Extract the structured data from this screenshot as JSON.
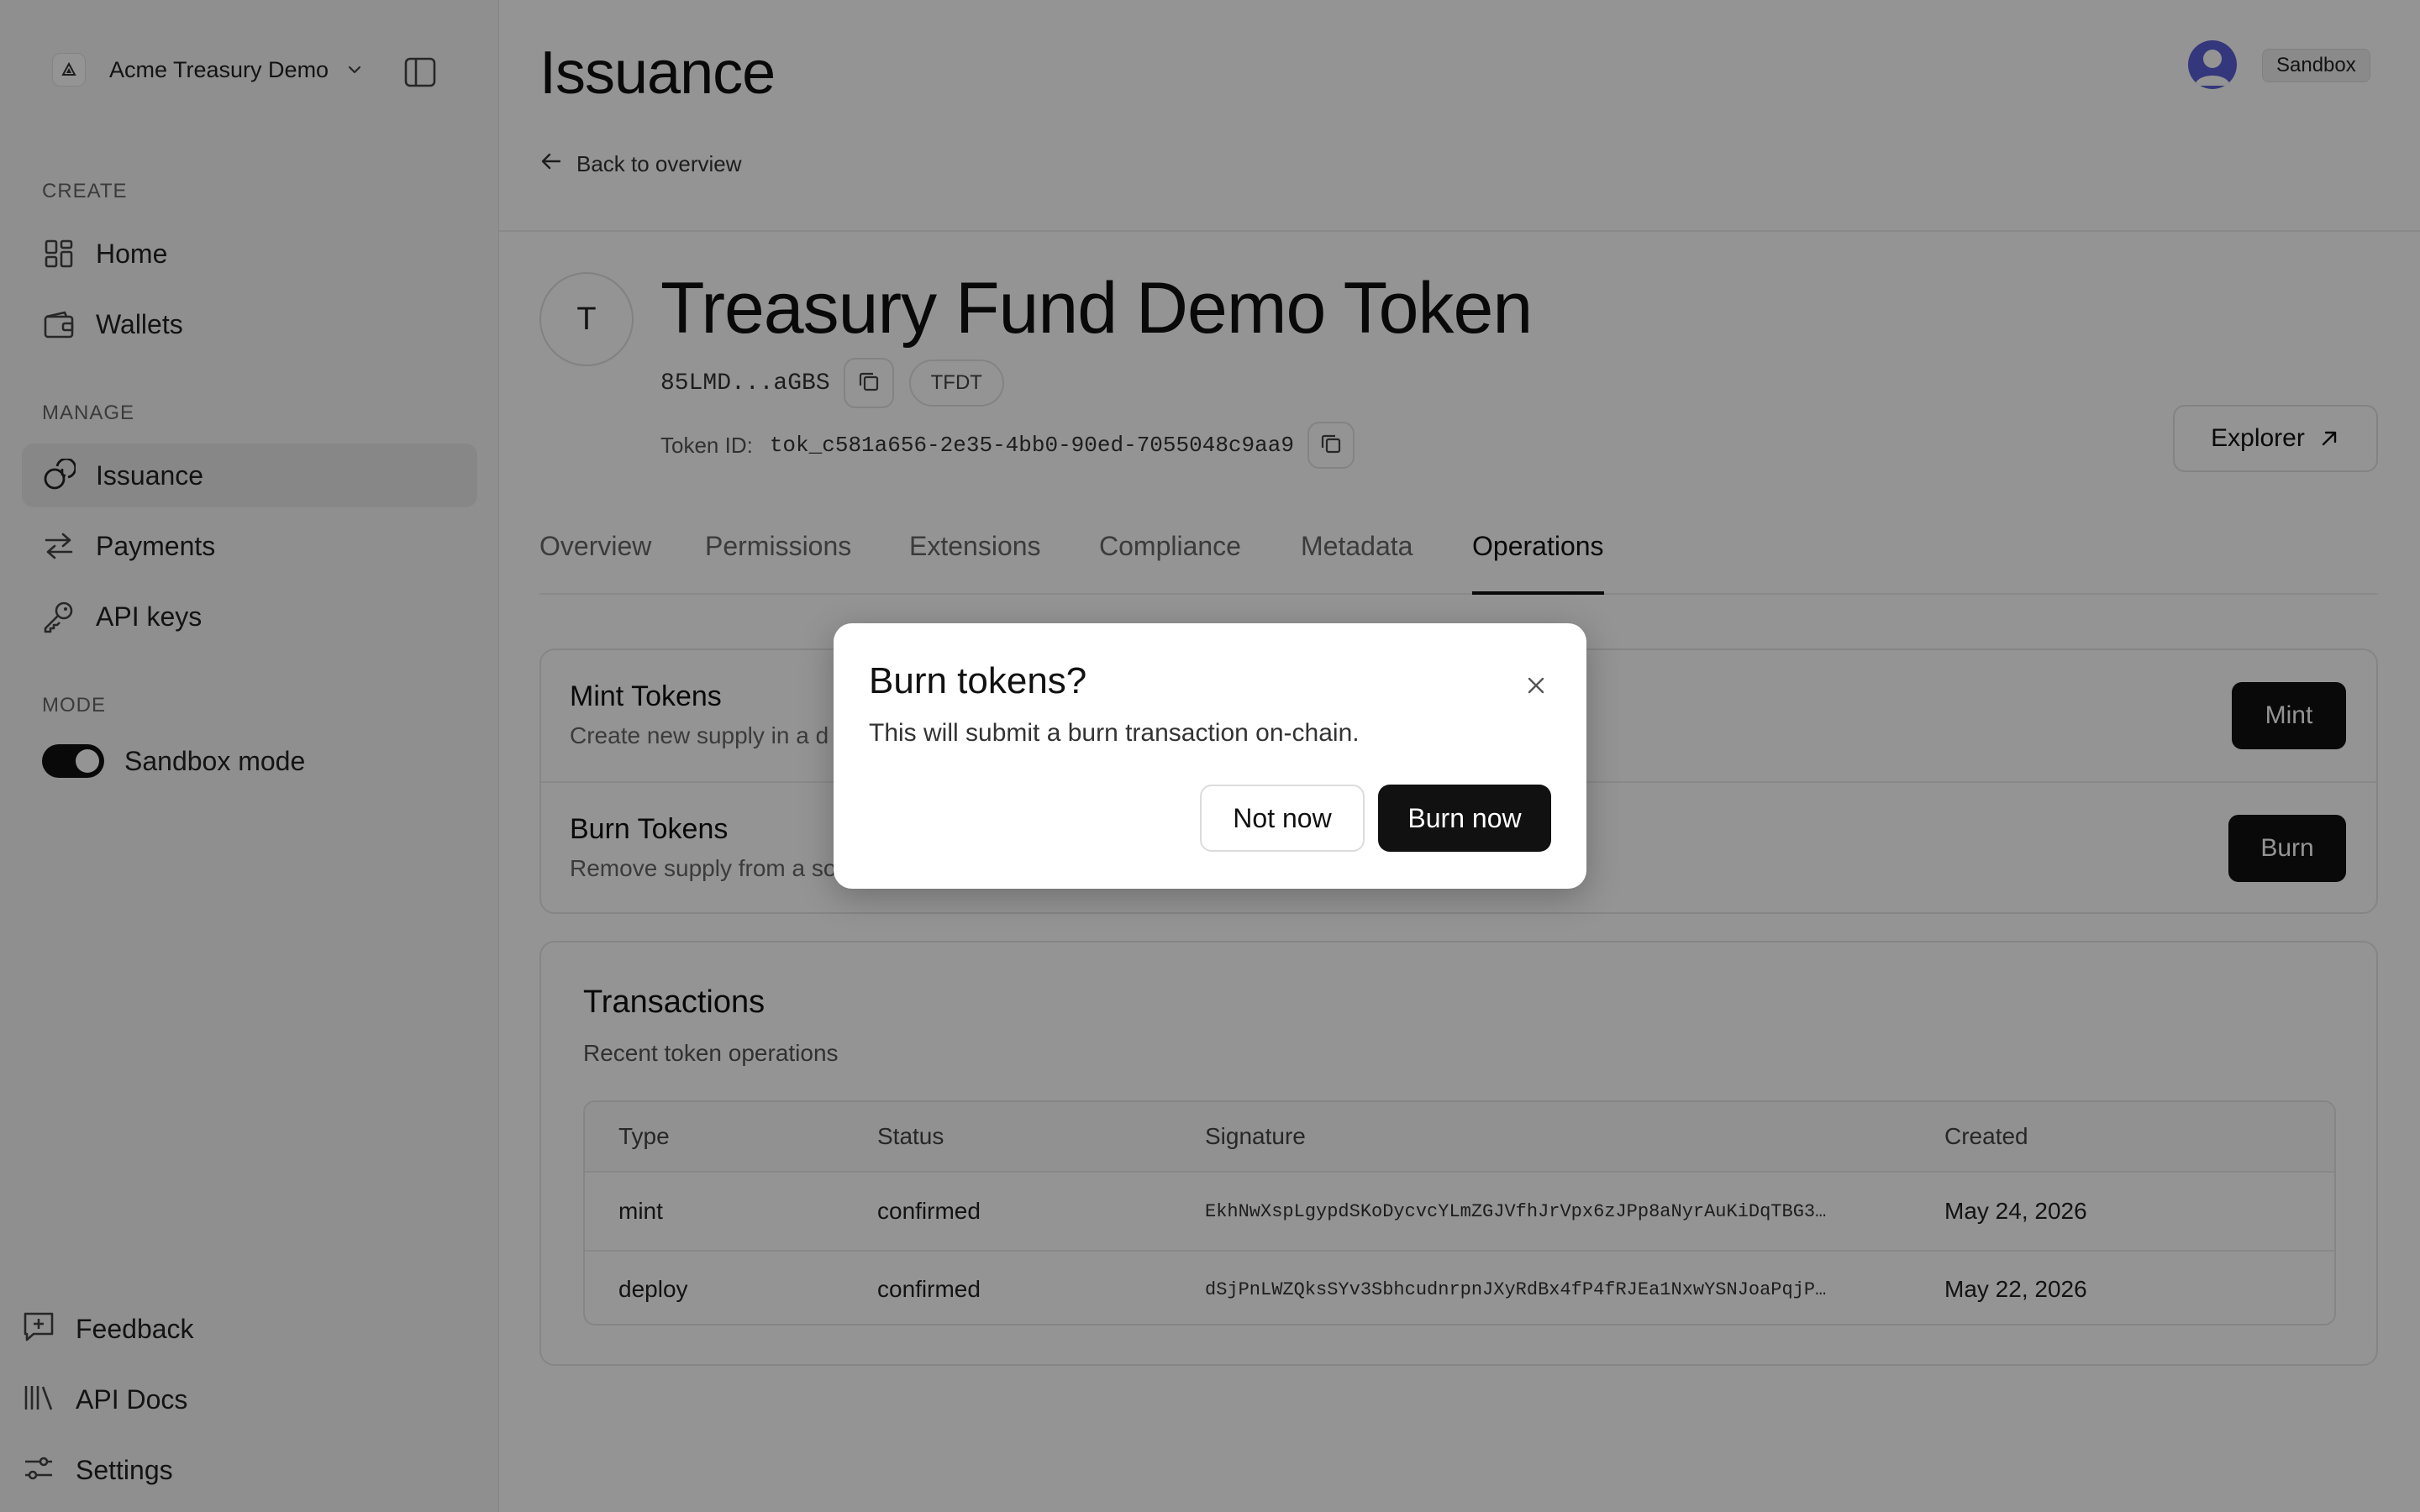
{
  "sidebar": {
    "org_name": "Acme Treasury Demo",
    "sections": {
      "create": "CREATE",
      "manage": "MANAGE",
      "mode": "MODE"
    },
    "nav": {
      "home": "Home",
      "wallets": "Wallets",
      "issuance": "Issuance",
      "payments": "Payments",
      "api_keys": "API keys"
    },
    "active_item": "issuance",
    "sandbox_toggle": {
      "label": "Sandbox mode",
      "on": true
    },
    "footer": {
      "feedback": "Feedback",
      "api_docs": "API Docs",
      "settings": "Settings"
    }
  },
  "header": {
    "title": "Issuance",
    "back_link": "Back to overview",
    "environment_badge": "Sandbox"
  },
  "token": {
    "avatar_letter": "T",
    "name": "Treasury Fund Demo Token",
    "address_short": "85LMD...aGBS",
    "symbol": "TFDT",
    "token_id_label": "Token ID:",
    "token_id": "tok_c581a656-2e35-4bb0-90ed-7055048c9aa9",
    "explorer_label": "Explorer"
  },
  "tabs": {
    "items": [
      "Overview",
      "Permissions",
      "Extensions",
      "Compliance",
      "Metadata",
      "Operations"
    ],
    "active": "Operations"
  },
  "operations": {
    "mint": {
      "title": "Mint Tokens",
      "description": "Create new supply in a d",
      "button": "Mint"
    },
    "burn": {
      "title": "Burn Tokens",
      "description": "Remove supply from a so",
      "button": "Burn"
    }
  },
  "transactions": {
    "title": "Transactions",
    "subtitle": "Recent token operations",
    "columns": [
      "Type",
      "Status",
      "Signature",
      "Created"
    ],
    "rows": [
      {
        "type": "mint",
        "status": "confirmed",
        "signature": "EkhNwXspLgypdSKoDycvcYLmZGJVfhJrVpx6zJPp8aNyrAuKiDqTBG3…",
        "created": "May 24, 2026"
      },
      {
        "type": "deploy",
        "status": "confirmed",
        "signature": "dSjPnLWZQksSYv3SbhcudnrpnJXyRdBx4fP4fRJEa1NxwYSNJoaPqjP…",
        "created": "May 22, 2026"
      }
    ]
  },
  "dialog": {
    "title": "Burn tokens?",
    "description": "This will submit a burn transaction on-chain.",
    "cancel_label": "Not now",
    "confirm_label": "Burn now"
  },
  "colors": {
    "primary": "#111111",
    "avatar": "#5a5fd6",
    "overlay": "rgba(0,0,0,0.42)"
  },
  "icons": {
    "org_logo": "triangle-logo-icon",
    "chevron": "chevron-down-icon",
    "panel": "sidebar-toggle-icon",
    "copy": "copy-icon",
    "external": "arrow-up-right-icon",
    "close": "close-icon",
    "back": "arrow-left-icon"
  }
}
